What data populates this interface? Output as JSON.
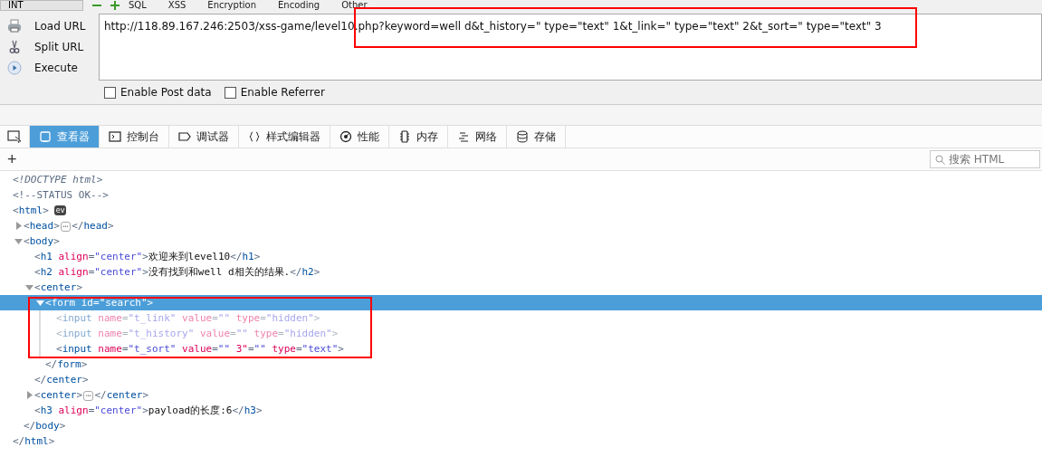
{
  "hackbar": {
    "menu_button": "INT",
    "menu": [
      "SQL",
      "XSS",
      "Encryption",
      "Encoding",
      "Other"
    ],
    "actions": [
      "Load URL",
      "Split URL",
      "Execute"
    ],
    "url": "http://118.89.167.246:2503/xss-game/level10.php?keyword=well d&t_history=\" type=\"text\" 1&t_link=\" type=\"text\" 2&t_sort=\" type=\"text\" 3",
    "options": [
      {
        "label": "Enable Post data",
        "checked": false
      },
      {
        "label": "Enable Referrer",
        "checked": false
      }
    ]
  },
  "devtools": {
    "tabs": [
      {
        "label": "查看器",
        "kind": "inspector",
        "selected": true
      },
      {
        "label": "控制台",
        "kind": "console",
        "selected": false
      },
      {
        "label": "调试器",
        "kind": "debugger",
        "selected": false
      },
      {
        "label": "样式编辑器",
        "kind": "style",
        "selected": false
      },
      {
        "label": "性能",
        "kind": "performance",
        "selected": false
      },
      {
        "label": "内存",
        "kind": "memory",
        "selected": false
      },
      {
        "label": "网络",
        "kind": "network",
        "selected": false
      },
      {
        "label": "存储",
        "kind": "storage",
        "selected": false
      }
    ],
    "add_button": "+",
    "search": {
      "placeholder": "搜索 HTML"
    },
    "tree": [
      {
        "selected": false,
        "dimmed": false,
        "tokens": [
          {
            "kind": "doctype",
            "text": "<!DOCTYPE html>"
          }
        ]
      },
      {
        "selected": false,
        "dimmed": false,
        "tokens": [
          {
            "kind": "comment",
            "text": "<!--STATUS OK-->"
          }
        ]
      },
      {
        "selected": false,
        "dimmed": false,
        "badge": "ev",
        "tokens": [
          {
            "kind": "punct",
            "text": "<"
          },
          {
            "kind": "tag",
            "text": "html"
          },
          {
            "kind": "punct",
            "text": ">"
          }
        ],
        "children": [
          {
            "selected": false,
            "dimmed": false,
            "expanded": false,
            "tokens": [
              {
                "kind": "punct",
                "text": "<"
              },
              {
                "kind": "tag",
                "text": "head"
              },
              {
                "kind": "punct",
                "text": ">"
              },
              {
                "kind": "more",
                "text": "⋯"
              },
              {
                "kind": "punct",
                "text": "</"
              },
              {
                "kind": "tag",
                "text": "head"
              },
              {
                "kind": "punct",
                "text": ">"
              }
            ]
          },
          {
            "selected": false,
            "dimmed": false,
            "expanded": true,
            "tokens": [
              {
                "kind": "punct",
                "text": "<"
              },
              {
                "kind": "tag",
                "text": "body"
              },
              {
                "kind": "punct",
                "text": ">"
              }
            ],
            "children": [
              {
                "selected": false,
                "dimmed": false,
                "tokens": [
                  {
                    "kind": "punct",
                    "text": "<"
                  },
                  {
                    "kind": "tag",
                    "text": "h1"
                  },
                  {
                    "kind": "attr",
                    "text": " align"
                  },
                  {
                    "kind": "punct",
                    "text": "="
                  },
                  {
                    "kind": "value",
                    "text": "\"center\""
                  },
                  {
                    "kind": "punct",
                    "text": ">"
                  },
                  {
                    "kind": "text",
                    "text": "欢迎来到level10"
                  },
                  {
                    "kind": "punct",
                    "text": "</"
                  },
                  {
                    "kind": "tag",
                    "text": "h1"
                  },
                  {
                    "kind": "punct",
                    "text": ">"
                  }
                ]
              },
              {
                "selected": false,
                "dimmed": false,
                "tokens": [
                  {
                    "kind": "punct",
                    "text": "<"
                  },
                  {
                    "kind": "tag",
                    "text": "h2"
                  },
                  {
                    "kind": "attr",
                    "text": " align"
                  },
                  {
                    "kind": "punct",
                    "text": "="
                  },
                  {
                    "kind": "value",
                    "text": "\"center\""
                  },
                  {
                    "kind": "punct",
                    "text": ">"
                  },
                  {
                    "kind": "text",
                    "text": "没有找到和well d相关的结果."
                  },
                  {
                    "kind": "punct",
                    "text": "</"
                  },
                  {
                    "kind": "tag",
                    "text": "h2"
                  },
                  {
                    "kind": "punct",
                    "text": ">"
                  }
                ]
              },
              {
                "selected": false,
                "dimmed": false,
                "expanded": true,
                "tokens": [
                  {
                    "kind": "punct",
                    "text": "<"
                  },
                  {
                    "kind": "tag",
                    "text": "center"
                  },
                  {
                    "kind": "punct",
                    "text": ">"
                  }
                ],
                "children": [
                  {
                    "selected": true,
                    "dimmed": false,
                    "expanded": true,
                    "tokens": [
                      {
                        "kind": "punct",
                        "text": "<"
                      },
                      {
                        "kind": "tag",
                        "text": "form"
                      },
                      {
                        "kind": "attr",
                        "text": " id"
                      },
                      {
                        "kind": "punct",
                        "text": "="
                      },
                      {
                        "kind": "value",
                        "text": "\"search\""
                      },
                      {
                        "kind": "punct",
                        "text": ">"
                      }
                    ],
                    "children": [
                      {
                        "selected": false,
                        "dimmed": true,
                        "tokens": [
                          {
                            "kind": "punct",
                            "text": "<"
                          },
                          {
                            "kind": "tag",
                            "text": "input"
                          },
                          {
                            "kind": "attr",
                            "text": " name"
                          },
                          {
                            "kind": "punct",
                            "text": "="
                          },
                          {
                            "kind": "value",
                            "text": "\"t_link\""
                          },
                          {
                            "kind": "attr",
                            "text": " value"
                          },
                          {
                            "kind": "punct",
                            "text": "="
                          },
                          {
                            "kind": "value",
                            "text": "\"\""
                          },
                          {
                            "kind": "attr",
                            "text": " type"
                          },
                          {
                            "kind": "punct",
                            "text": "="
                          },
                          {
                            "kind": "value",
                            "text": "\"hidden\""
                          },
                          {
                            "kind": "punct",
                            "text": ">"
                          }
                        ]
                      },
                      {
                        "selected": false,
                        "dimmed": true,
                        "tokens": [
                          {
                            "kind": "punct",
                            "text": "<"
                          },
                          {
                            "kind": "tag",
                            "text": "input"
                          },
                          {
                            "kind": "attr",
                            "text": " name"
                          },
                          {
                            "kind": "punct",
                            "text": "="
                          },
                          {
                            "kind": "value",
                            "text": "\"t_history\""
                          },
                          {
                            "kind": "attr",
                            "text": " value"
                          },
                          {
                            "kind": "punct",
                            "text": "="
                          },
                          {
                            "kind": "value",
                            "text": "\"\""
                          },
                          {
                            "kind": "attr",
                            "text": " type"
                          },
                          {
                            "kind": "punct",
                            "text": "="
                          },
                          {
                            "kind": "value",
                            "text": "\"hidden\""
                          },
                          {
                            "kind": "punct",
                            "text": ">"
                          }
                        ]
                      },
                      {
                        "selected": false,
                        "dimmed": false,
                        "tokens": [
                          {
                            "kind": "punct",
                            "text": "<"
                          },
                          {
                            "kind": "tag",
                            "text": "input"
                          },
                          {
                            "kind": "attr",
                            "text": " name"
                          },
                          {
                            "kind": "punct",
                            "text": "="
                          },
                          {
                            "kind": "value",
                            "text": "\"t_sort\""
                          },
                          {
                            "kind": "attr",
                            "text": " value"
                          },
                          {
                            "kind": "punct",
                            "text": "="
                          },
                          {
                            "kind": "value",
                            "text": "\"\""
                          },
                          {
                            "kind": "attr",
                            "text": " 3\""
                          },
                          {
                            "kind": "punct",
                            "text": "="
                          },
                          {
                            "kind": "value",
                            "text": "\"\""
                          },
                          {
                            "kind": "attr",
                            "text": " type"
                          },
                          {
                            "kind": "punct",
                            "text": "="
                          },
                          {
                            "kind": "value",
                            "text": "\"text\""
                          },
                          {
                            "kind": "punct",
                            "text": ">"
                          }
                        ]
                      }
                    ]
                  },
                  {
                    "selected": false,
                    "dimmed": false,
                    "tokens": [
                      {
                        "kind": "punct",
                        "text": "</"
                      },
                      {
                        "kind": "tag",
                        "text": "form"
                      },
                      {
                        "kind": "punct",
                        "text": ">"
                      }
                    ]
                  }
                ]
              },
              {
                "selected": false,
                "dimmed": false,
                "tokens": [
                  {
                    "kind": "punct",
                    "text": "</"
                  },
                  {
                    "kind": "tag",
                    "text": "center"
                  },
                  {
                    "kind": "punct",
                    "text": ">"
                  }
                ]
              },
              {
                "selected": false,
                "dimmed": false,
                "expanded": false,
                "tokens": [
                  {
                    "kind": "punct",
                    "text": "<"
                  },
                  {
                    "kind": "tag",
                    "text": "center"
                  },
                  {
                    "kind": "punct",
                    "text": ">"
                  },
                  {
                    "kind": "more",
                    "text": "⋯"
                  },
                  {
                    "kind": "punct",
                    "text": "</"
                  },
                  {
                    "kind": "tag",
                    "text": "center"
                  },
                  {
                    "kind": "punct",
                    "text": ">"
                  }
                ]
              },
              {
                "selected": false,
                "dimmed": false,
                "tokens": [
                  {
                    "kind": "punct",
                    "text": "<"
                  },
                  {
                    "kind": "tag",
                    "text": "h3"
                  },
                  {
                    "kind": "attr",
                    "text": " align"
                  },
                  {
                    "kind": "punct",
                    "text": "="
                  },
                  {
                    "kind": "value",
                    "text": "\"center\""
                  },
                  {
                    "kind": "punct",
                    "text": ">"
                  },
                  {
                    "kind": "text",
                    "text": "payload的长度:6"
                  },
                  {
                    "kind": "punct",
                    "text": "</"
                  },
                  {
                    "kind": "tag",
                    "text": "h3"
                  },
                  {
                    "kind": "punct",
                    "text": ">"
                  }
                ]
              }
            ]
          },
          {
            "selected": false,
            "dimmed": false,
            "tokens": [
              {
                "kind": "punct",
                "text": "</"
              },
              {
                "kind": "tag",
                "text": "body"
              },
              {
                "kind": "punct",
                "text": ">"
              }
            ]
          }
        ]
      },
      {
        "selected": false,
        "dimmed": false,
        "tokens": [
          {
            "kind": "punct",
            "text": "</"
          },
          {
            "kind": "tag",
            "text": "html"
          },
          {
            "kind": "punct",
            "text": ">"
          }
        ]
      }
    ]
  }
}
